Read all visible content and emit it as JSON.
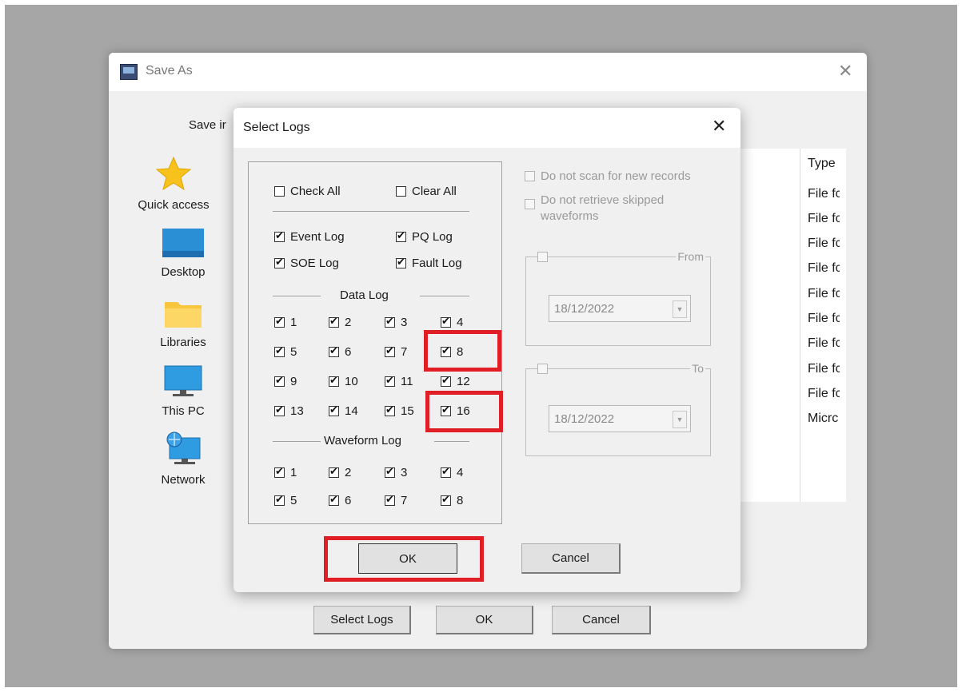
{
  "save_as": {
    "title": "Save As",
    "close_glyph": "✕",
    "save_in_label": "Save ir",
    "nav": [
      {
        "label": "Quick access",
        "icon": "star-icon"
      },
      {
        "label": "Desktop",
        "icon": "desktop-icon"
      },
      {
        "label": "Libraries",
        "icon": "folder-icon"
      },
      {
        "label": "This PC",
        "icon": "computer-icon"
      },
      {
        "label": "Network",
        "icon": "network-icon"
      }
    ],
    "list": {
      "type_header": "Type",
      "rows": [
        "File fc",
        "File fc",
        "File fc",
        "File fc",
        "File fc",
        "File fc",
        "File fc",
        "File fc",
        "File fc",
        "Micrc"
      ]
    },
    "buttons": {
      "select_logs": "Select Logs",
      "ok": "OK",
      "cancel": "Cancel"
    }
  },
  "select_logs": {
    "title": "Select Logs",
    "close_glyph": "✕",
    "check_all": "Check All",
    "clear_all": "Clear All",
    "logs": [
      {
        "label": "Event Log",
        "checked": true
      },
      {
        "label": "PQ Log",
        "checked": true
      },
      {
        "label": "SOE Log",
        "checked": true
      },
      {
        "label": "Fault Log",
        "checked": true
      }
    ],
    "data_log_label": "Data Log",
    "data_logs": [
      "1",
      "2",
      "3",
      "4",
      "5",
      "6",
      "7",
      "8",
      "9",
      "10",
      "11",
      "12",
      "13",
      "14",
      "15",
      "16"
    ],
    "waveform_log_label": "Waveform Log",
    "waveform_logs": [
      "1",
      "2",
      "3",
      "4",
      "5",
      "6",
      "7",
      "8"
    ],
    "options": {
      "no_scan": "Do not scan for new records",
      "no_retrieve_line1": "Do not retrieve skipped",
      "no_retrieve_line2": "waveforms"
    },
    "from": {
      "label": "From",
      "date": "18/12/2022"
    },
    "to": {
      "label": "To",
      "date": "18/12/2022"
    },
    "ok": "OK",
    "cancel": "Cancel"
  },
  "colors": {
    "highlight": "#e01e26"
  }
}
